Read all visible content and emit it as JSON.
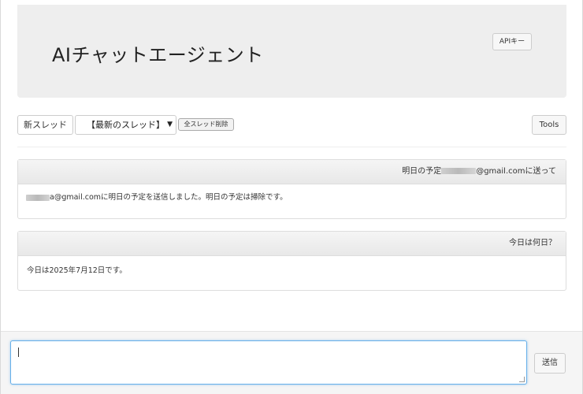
{
  "header": {
    "title": "AIチャットエージェント",
    "api_key_label": "APIキー"
  },
  "toolbar": {
    "new_thread_label": "新スレッド",
    "thread_select_value": "【最新のスレッド】",
    "delete_all_label": "全スレッド削除",
    "tools_label": "Tools"
  },
  "messages": [
    {
      "question_prefix": "明日の予定",
      "question_suffix": "@gmail.comに送って",
      "answer_prefix": "",
      "answer_suffix": "a@gmail.comに明日の予定を送信しました。明日の予定は掃除です。"
    },
    {
      "question": "今日は何日？",
      "answer": "今日は2025年7月12日です。"
    }
  ],
  "composer": {
    "input_value": "",
    "send_label": "送信"
  },
  "icons": {
    "select_chevron": "chevron-down-icon"
  }
}
